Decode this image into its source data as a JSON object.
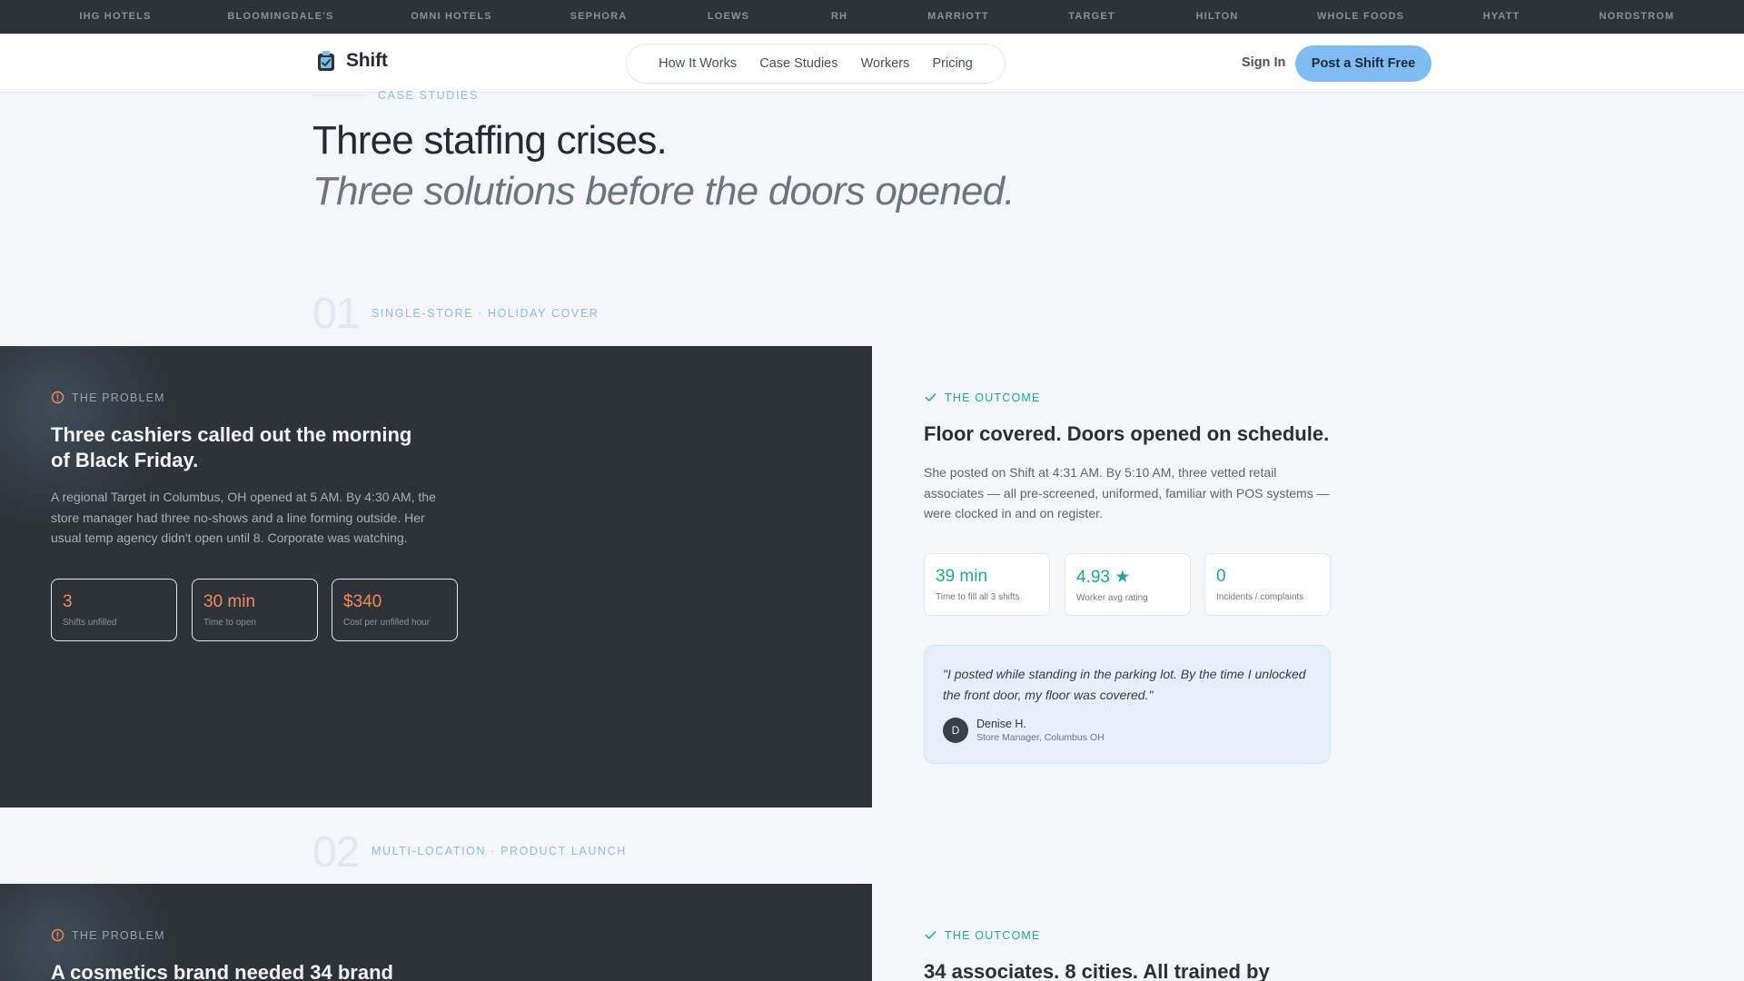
{
  "ticker": [
    "IHG HOTELS",
    "BLOOMINGDALE'S",
    "OMNI HOTELS",
    "SEPHORA",
    "LOEWS",
    "RH",
    "MARRIOTT",
    "TARGET",
    "HILTON",
    "WHOLE FOODS",
    "HYATT",
    "NORDSTROM"
  ],
  "header": {
    "brand": "Shift",
    "nav": [
      "How It Works",
      "Case Studies",
      "Workers",
      "Pricing"
    ],
    "signin": "Sign In",
    "cta": "Post a Shift Free"
  },
  "hero": {
    "eyebrow": "CASE STUDIES",
    "title": "Three staffing crises.",
    "subtitle": "Three solutions before the doors opened."
  },
  "cases": [
    {
      "number": "01",
      "tag": "SINGLE-STORE · HOLIDAY COVER",
      "problem": {
        "label": "THE PROBLEM",
        "title": "Three cashiers called out the morning of Black Friday.",
        "body": "A regional Target in Columbus, OH opened at 5 AM. By 4:30 AM, the store manager had three no-shows and a line forming outside. Her usual temp agency didn't open until 8. Corporate was watching.",
        "stats": [
          {
            "value": "3",
            "label": "Shifts unfilled"
          },
          {
            "value": "30 min",
            "label": "Time to open"
          },
          {
            "value": "$340",
            "label": "Cost per unfilled hour"
          }
        ]
      },
      "outcome": {
        "label": "THE OUTCOME",
        "title": "Floor covered. Doors opened on schedule.",
        "body": "She posted on Shift at 4:31 AM. By 5:10 AM, three vetted retail associates — all pre-screened, uniformed, familiar with POS systems — were clocked in and on register.",
        "stats": [
          {
            "value": "39 min",
            "label": "Time to fill all 3 shifts"
          },
          {
            "value": "4.93 ★",
            "label": "Worker avg rating"
          },
          {
            "value": "0",
            "label": "Incidents / complaints"
          }
        ],
        "quote": {
          "text": "\"I posted while standing in the parking lot. By the time I unlocked the front door, my floor was covered.\"",
          "initial": "D",
          "name": "Denise H.",
          "role": "Store Manager, Columbus OH"
        }
      }
    },
    {
      "number": "02",
      "tag": "MULTI-LOCATION · PRODUCT LAUNCH",
      "problem": {
        "label": "THE PROBLEM",
        "title": "A cosmetics brand needed 34 brand"
      },
      "outcome": {
        "label": "THE OUTCOME",
        "title": "34 associates. 8 cities. All trained by"
      }
    }
  ],
  "colors": {
    "dark_panel": "#2e3338",
    "accent_orange": "#ef8a5f",
    "accent_teal": "#1fa890",
    "cta_blue": "#7fbcf2"
  }
}
